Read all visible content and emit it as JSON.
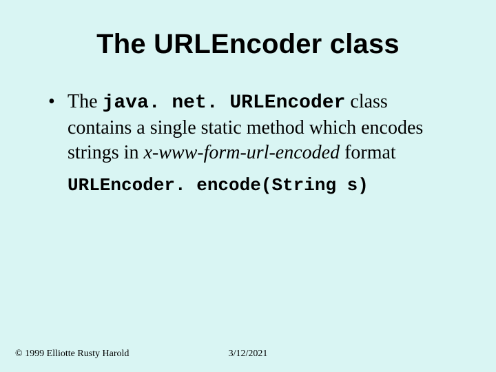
{
  "title": "The URLEncoder class",
  "bullet": {
    "pre": "The ",
    "code": "java. net. URLEncoder",
    "mid": " class contains a single static method which encodes strings in ",
    "ital": "x-www-form-url-encoded",
    "post": " format"
  },
  "code_line": "URLEncoder. encode(String s)",
  "footer": {
    "copyright": "© 1999 Elliotte Rusty Harold",
    "date": "3/12/2021"
  }
}
